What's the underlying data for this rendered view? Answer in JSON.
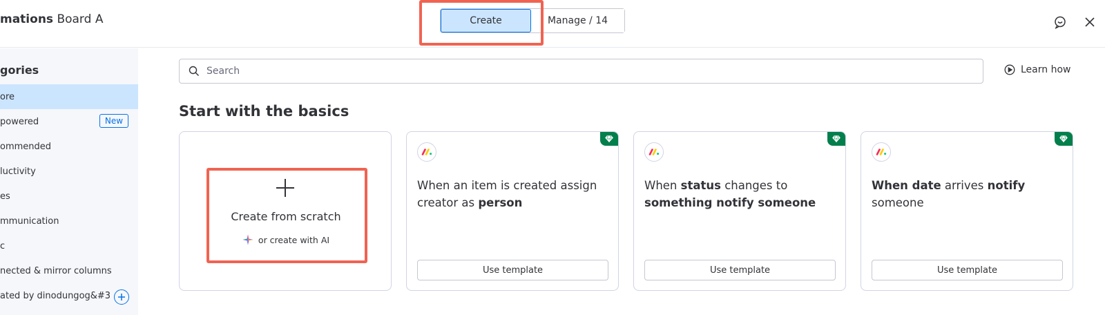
{
  "header": {
    "brand_bold": "mations",
    "brand_rest": " Board A",
    "tabs": {
      "create": "Create",
      "manage": "Manage / 14"
    }
  },
  "sidebar": {
    "title": "gories",
    "items": [
      {
        "label": "ore",
        "active": true
      },
      {
        "label": "powered",
        "badge": "New"
      },
      {
        "label": "ommended"
      },
      {
        "label": "luctivity"
      },
      {
        "label": "es"
      },
      {
        "label": "mmunication"
      },
      {
        "label": "c"
      },
      {
        "label": "nected & mirror columns"
      },
      {
        "label": "ated by dinodungog&#3..."
      }
    ]
  },
  "search": {
    "placeholder": "Search"
  },
  "learn_how": "Learn how",
  "section_title": "Start with the basics",
  "scratch_card": {
    "title": "Create from scratch",
    "ai_label": "or create with AI"
  },
  "templates": [
    {
      "parts": [
        {
          "t": "When an item is created assign creator as ",
          "b": false
        },
        {
          "t": "person",
          "b": true
        }
      ],
      "button": "Use template"
    },
    {
      "parts": [
        {
          "t": "When ",
          "b": false
        },
        {
          "t": "status",
          "b": true
        },
        {
          "t": " changes to ",
          "b": false
        },
        {
          "t": "something notify someone",
          "b": true
        }
      ],
      "button": "Use template"
    },
    {
      "parts": [
        {
          "t": "When date",
          "b": true
        },
        {
          "t": " arrives ",
          "b": false
        },
        {
          "t": "notify",
          "b": true
        },
        {
          "t": " someone",
          "b": false
        }
      ],
      "button": "Use template"
    }
  ],
  "colors": {
    "accent": "#0073ea",
    "highlight": "#f06352",
    "premium": "#037f4c",
    "selected_bg": "#cce5ff",
    "sidebar_bg": "#f6f7fb"
  }
}
